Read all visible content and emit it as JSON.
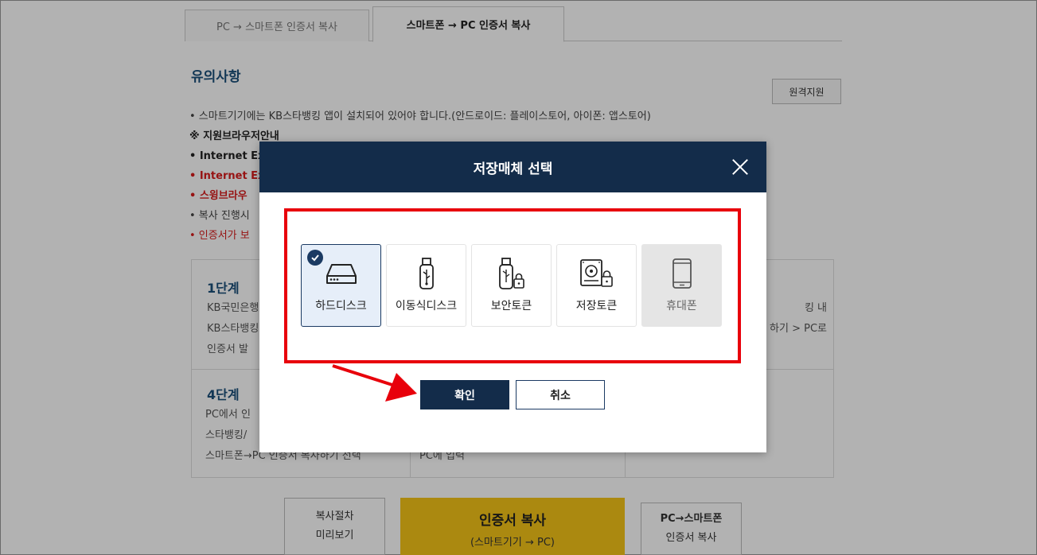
{
  "tabs": [
    {
      "label": "PC → 스마트폰 인증서 복사"
    },
    {
      "label": "스마트폰 → PC 인증서 복사"
    }
  ],
  "notice": {
    "title": "유의사항",
    "remote_button": "원격지원",
    "lines": [
      "• 스마트기기에는 KB스타뱅킹 앱이 설치되어 있어야 합니다.(안드로이드: 플레이스토어, 아이폰: 앱스토어)",
      "※ 지원브라우저안내",
      "• Internet Ex",
      "• Internet Ex",
      "• 스윙브라우",
      "• 복사 진행시",
      "• 인증서가 보"
    ]
  },
  "steps": {
    "step1_title": "1단계",
    "step1_lines": [
      "KB국민은행",
      "KB스타뱅킹",
      "인증서 발"
    ],
    "step3_lines": [
      "킹 내",
      "하기 > PC로"
    ],
    "step4_title": "4단계",
    "step4_lines": [
      "PC에서 인",
      "스타뱅킹/",
      "스마트폰→PC 인증서 복사하기 선택"
    ],
    "step5_lines": [
      "PC에 입력"
    ]
  },
  "bottom": {
    "preview_line1": "복사절차",
    "preview_line2": "미리보기",
    "copy_main": "인증서 복사",
    "copy_sub": "(스마트기기 → PC)",
    "switch_line1": "PC→스마트폰",
    "switch_line2": "인증서 복사"
  },
  "modal": {
    "title": "저장매체 선택",
    "options": [
      {
        "label": "하드디스크",
        "icon": "hard-disk-icon",
        "state": "selected"
      },
      {
        "label": "이동식디스크",
        "icon": "usb-drive-icon",
        "state": "normal"
      },
      {
        "label": "보안토큰",
        "icon": "security-token-icon",
        "state": "normal"
      },
      {
        "label": "저장토큰",
        "icon": "storage-token-icon",
        "state": "normal"
      },
      {
        "label": "휴대폰",
        "icon": "mobile-phone-icon",
        "state": "disabled"
      }
    ],
    "confirm_label": "확인",
    "cancel_label": "취소"
  },
  "colors": {
    "modal_header": "#132c4a",
    "highlight": "#e8000b",
    "copy_button": "#f5c518",
    "notice_title": "#1b4f7a"
  }
}
